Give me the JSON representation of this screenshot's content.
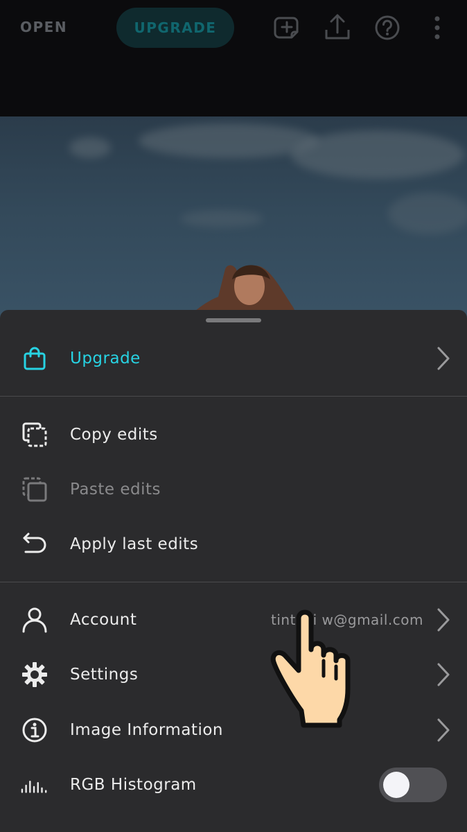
{
  "topbar": {
    "open_label": "OPEN",
    "upgrade_label": "UPGRADE",
    "icons": [
      "add-icon",
      "share-icon",
      "help-icon",
      "more-icon"
    ]
  },
  "sheet": {
    "upgrade": {
      "label": "Upgrade",
      "icon": "shopping-bag-icon",
      "color": "#27d3e3"
    },
    "copy_edits": {
      "label": "Copy edits",
      "icon": "copy-icon"
    },
    "paste_edits": {
      "label": "Paste edits",
      "icon": "paste-icon",
      "disabled": true
    },
    "apply_last_edits": {
      "label": "Apply last edits",
      "icon": "undo-icon"
    },
    "account": {
      "label": "Account",
      "value": "tintuci   w@gmail.com",
      "icon": "user-icon"
    },
    "settings": {
      "label": "Settings",
      "icon": "gear-icon"
    },
    "image_information": {
      "label": "Image Information",
      "icon": "info-icon"
    },
    "rgb_histogram": {
      "label": "RGB Histogram",
      "icon": "histogram-icon",
      "enabled": false
    }
  },
  "colors": {
    "accent": "#27d3e3",
    "sheet_background": "#2b2b2d",
    "topbar_background": "#0b0b0d"
  }
}
